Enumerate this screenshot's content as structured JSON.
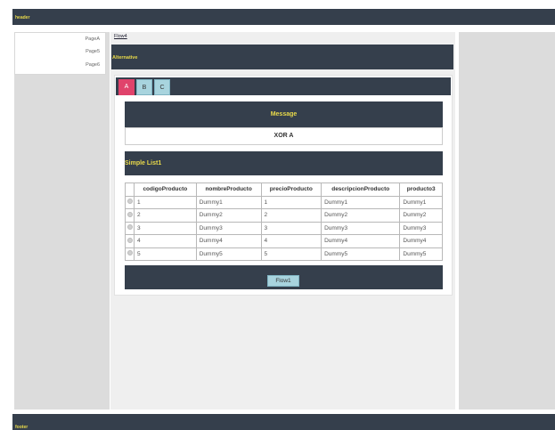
{
  "header": {
    "label": "header"
  },
  "footer": {
    "label": "footer"
  },
  "nav": {
    "items": [
      {
        "label": "PageA"
      },
      {
        "label": "Page5"
      },
      {
        "label": "Page6"
      }
    ]
  },
  "breadcrumb": {
    "flow_link": "Flow4"
  },
  "alternative": {
    "title": "Alternative"
  },
  "tabs": [
    {
      "label": "A",
      "active": true
    },
    {
      "label": "B"
    },
    {
      "label": "C"
    }
  ],
  "message": {
    "title": "Message",
    "text": "XOR A"
  },
  "list": {
    "title": "Simple List1",
    "columns": [
      "codigoProducto",
      "nombreProducto",
      "precioProducto",
      "descripcionProducto",
      "producto3"
    ],
    "rows": [
      [
        "1",
        "Dummy1",
        "1",
        "Dummy1",
        "Dummy1"
      ],
      [
        "2",
        "Dummy2",
        "2",
        "Dummy2",
        "Dummy2"
      ],
      [
        "3",
        "Dummy3",
        "3",
        "Dummy3",
        "Dummy3"
      ],
      [
        "4",
        "Dummy4",
        "4",
        "Dummy4",
        "Dummy4"
      ],
      [
        "5",
        "Dummy5",
        "5",
        "Dummy5",
        "Dummy5"
      ]
    ]
  },
  "flow_button": {
    "label": "Flow1"
  },
  "colors": {
    "bar": "#353f4c",
    "bar_text": "#e8d94a",
    "active_tab": "#e0436b",
    "button": "#a8d4de"
  }
}
